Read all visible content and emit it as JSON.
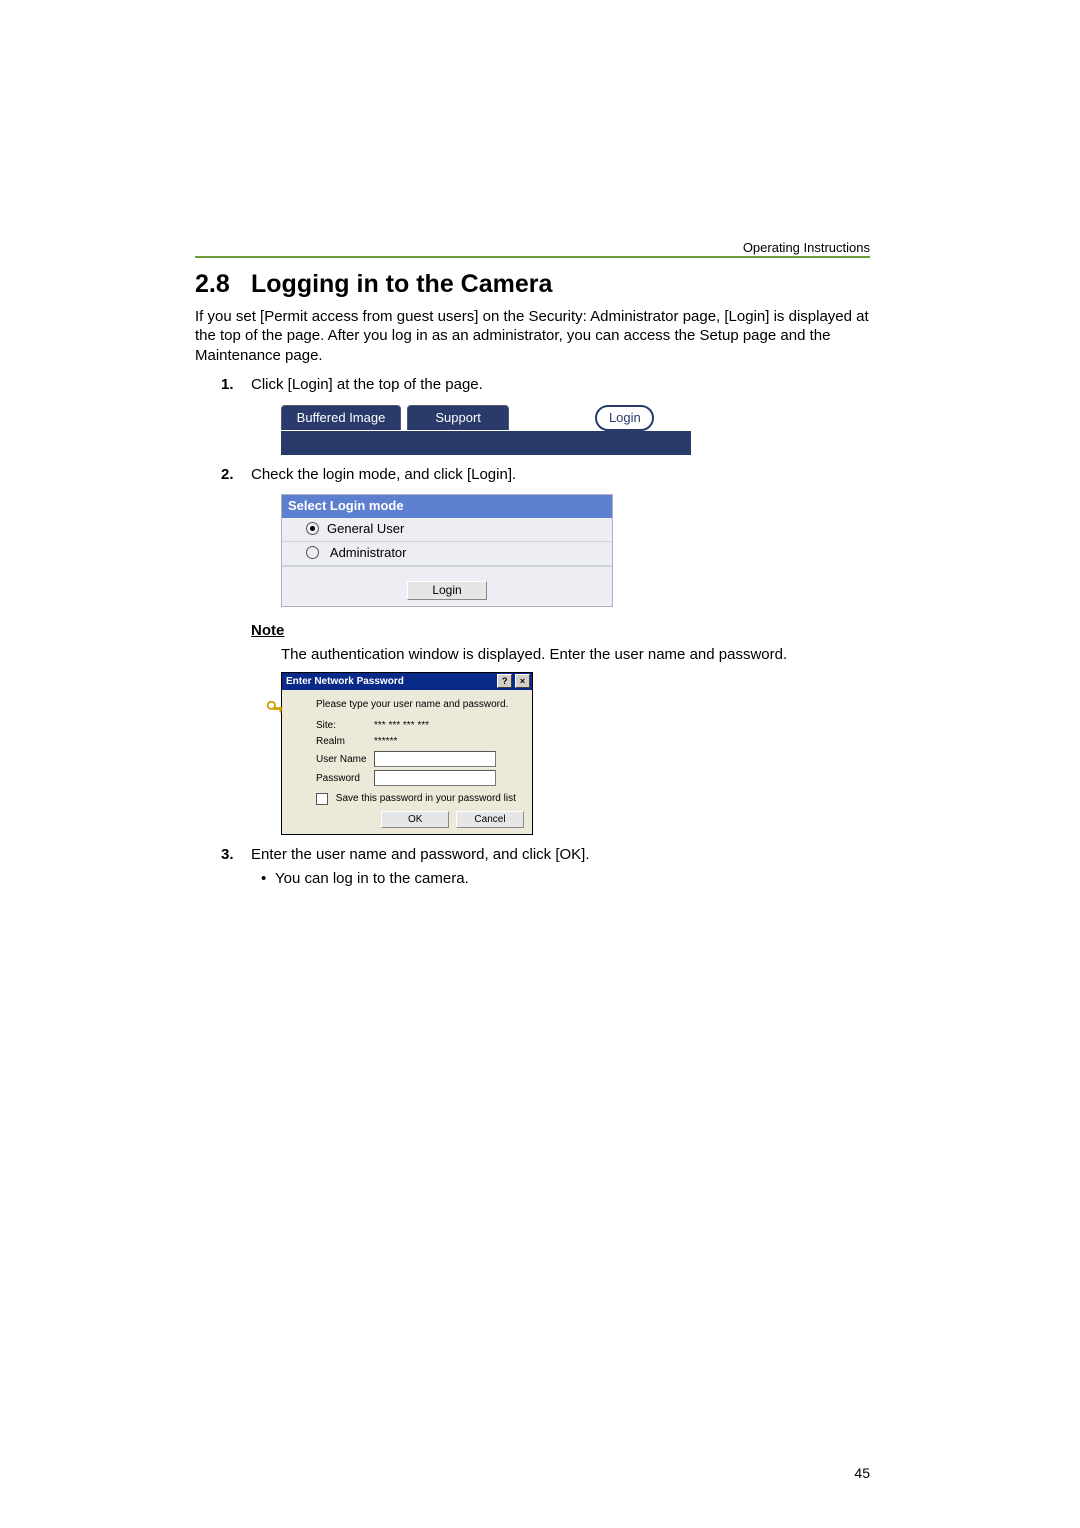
{
  "header": {
    "doc_title": "Operating Instructions"
  },
  "section": {
    "number": "2.8",
    "title": "Logging in to the Camera",
    "intro": "If you set [Permit access from guest users] on the Security: Administrator page, [Login] is displayed at the top of the page. After you log in as an administrator, you can access the Setup page and the Maintenance page."
  },
  "steps": {
    "s1": "Click [Login] at the top of the page.",
    "s2": "Check the login mode, and click [Login].",
    "s3": "Enter the user name and password, and click [OK].",
    "s3_bullet": "You can log in to the camera."
  },
  "note": {
    "head": "Note",
    "body": "The authentication window is displayed. Enter the user name and password."
  },
  "fig1": {
    "tab1": "Buffered Image",
    "tab2": "Support",
    "login": "Login"
  },
  "fig2": {
    "title": "Select Login mode",
    "opt1": "General User",
    "opt2": "Administrator",
    "login_btn": "Login"
  },
  "fig3": {
    "title": "Enter Network Password",
    "msg": "Please type your user name and password.",
    "site_label": "Site:",
    "site_value": "*** *** *** ***",
    "realm_label": "Realm",
    "realm_value": "******",
    "user_label": "User Name",
    "pass_label": "Password",
    "save_label": "Save this password in your password list",
    "ok": "OK",
    "cancel": "Cancel"
  },
  "page_number": "45"
}
